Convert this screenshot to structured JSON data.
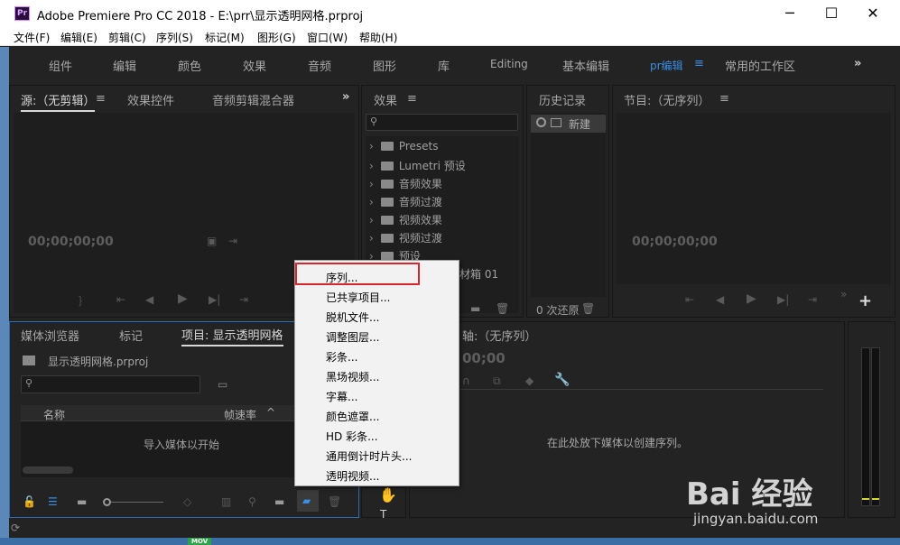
{
  "window": {
    "app_icon": "Pr",
    "title": "Adobe Premiere Pro CC 2018 - E:\\prr\\显示透明网格.prproj",
    "controls": {
      "minimize": "─",
      "maximize": "☐",
      "close": "✕"
    }
  },
  "menubar": [
    "文件(F)",
    "编辑(E)",
    "剪辑(C)",
    "序列(S)",
    "标记(M)",
    "图形(G)",
    "窗口(W)",
    "帮助(H)"
  ],
  "workspaces": {
    "tabs": [
      "组件",
      "编辑",
      "颜色",
      "效果",
      "音频",
      "图形",
      "库",
      "Editing",
      "基本编辑",
      "pr编辑",
      "常用的工作区"
    ],
    "active": "pr编辑",
    "active_menu_glyph": "≡",
    "overflow_glyph": "»",
    "accent_color": "#3a8ee6"
  },
  "source_panel": {
    "tabs": [
      "源:（无剪辑）",
      "效果控件",
      "音频剪辑混合器"
    ],
    "menu_glyph": "≡",
    "overflow_glyph": "»",
    "timecode": "00;00;00;00"
  },
  "effects_panel": {
    "title": "效果",
    "menu_glyph": "≡",
    "tree": [
      "Presets",
      "Lumetri 预设",
      "音频效果",
      "音频过渡",
      "视频效果",
      "视频过渡",
      "预设"
    ],
    "partial_label": "材箱 01"
  },
  "history_panel": {
    "title": "历史记录",
    "item": "新建",
    "footer": "0 次还原"
  },
  "program_panel": {
    "title": "节目:（无序列）",
    "menu_glyph": "≡",
    "timecode": "00;00;00;00",
    "add_glyph": "+"
  },
  "project_panel": {
    "tabs": [
      "媒体浏览器",
      "标记",
      "项目: 显示透明网格"
    ],
    "file": "显示透明网格.prproj",
    "columns": [
      "名称",
      "帧速率"
    ],
    "empty_message": "导入媒体以开始"
  },
  "timeline_panel": {
    "title": "时间轴:（无序列）",
    "title_visible": "轴:（无序列）",
    "timecode_partial": "00;00",
    "empty_message": "在此处放下媒体以创建序列。"
  },
  "context_menu": {
    "items": [
      "序列...",
      "已共享项目...",
      "脱机文件...",
      "调整图层...",
      "彩条...",
      "黑场视频...",
      "字幕...",
      "颜色遮罩...",
      "HD 彩条...",
      "通用倒计时片头...",
      "透明视频..."
    ],
    "highlighted": "序列...",
    "highlight_color": "#d9262d"
  },
  "watermark": {
    "brand": "Bai 经验",
    "url": "jingyan.baidu.com"
  },
  "taskbar": {
    "badge": "MOV"
  }
}
